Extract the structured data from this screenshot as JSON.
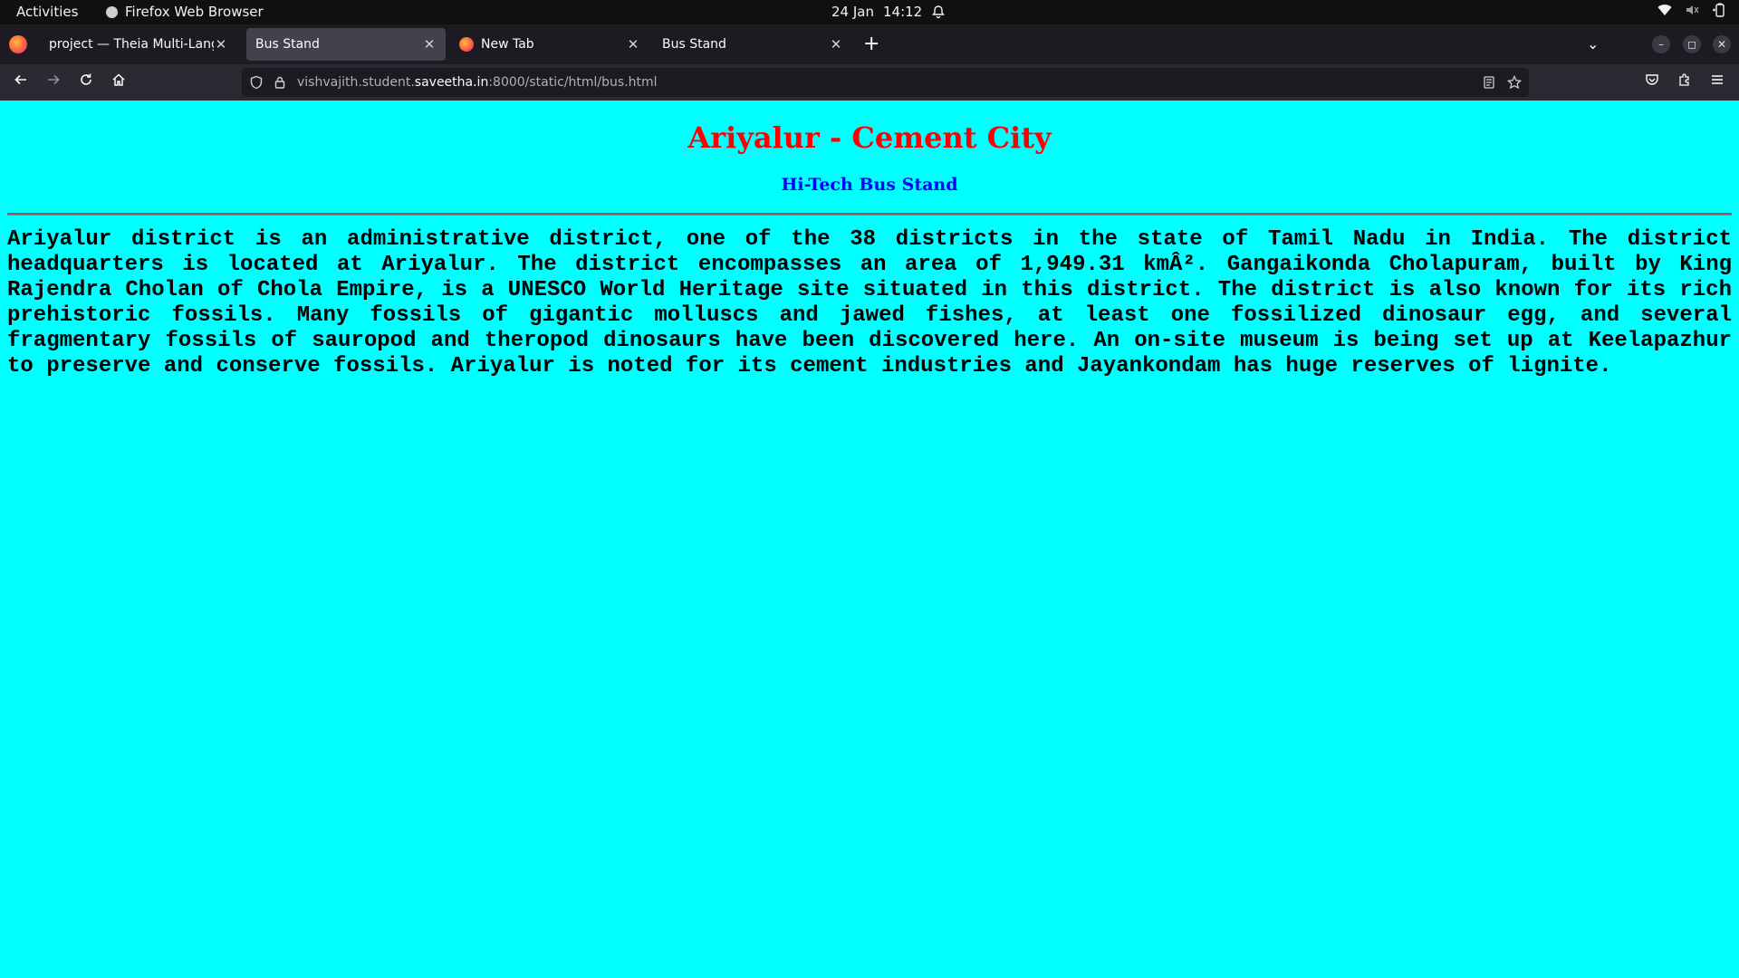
{
  "system_bar": {
    "activities": "Activities",
    "app_name": "Firefox Web Browser",
    "date": "24 Jan",
    "time": "14:12",
    "icons": [
      "bell-icon",
      "wifi-icon",
      "volume-muted-icon",
      "battery-icon"
    ]
  },
  "tabs": [
    {
      "label": "project — Theia Multi-Language",
      "active": false,
      "favicon": "theia-icon"
    },
    {
      "label": "Bus Stand",
      "active": true,
      "favicon": ""
    },
    {
      "label": "New Tab",
      "active": false,
      "favicon": "firefox-icon"
    },
    {
      "label": "Bus Stand",
      "active": false,
      "favicon": ""
    }
  ],
  "toolbar": {
    "new_tab": "+",
    "list_tabs": "⌄",
    "minimize": "–",
    "maximize": "◻",
    "close": "✕"
  },
  "navbar": {
    "url_prefix": "vishvajith.student.",
    "url_host": "saveetha.in",
    "url_suffix": ":8000/static/html/bus.html"
  },
  "page": {
    "background": "#00ffff",
    "title": "Ariyalur - Cement City",
    "title_color": "#ff0000",
    "subtitle": "Hi-Tech Bus Stand",
    "subtitle_color": "#0000ff",
    "body": "Ariyalur district is an administrative district, one of the 38 districts in the state of Tamil Nadu in India. The district headquarters is located at Ariyalur. The district encompasses an area of 1,949.31 kmÂ². Gangaikonda Cholapuram, built by King Rajendra Cholan of Chola Empire, is a UNESCO World Heritage site situated in this district. The district is also known for its rich prehistoric fossils. Many fossils of gigantic molluscs and jawed fishes, at least one fossilized dinosaur egg, and several fragmentary fossils of sauropod and theropod dinosaurs have been discovered here. An on-site museum is being set up at Keelapazhur to preserve and conserve fossils. Ariyalur is noted for its cement industries and Jayankondam has huge reserves of lignite."
  }
}
